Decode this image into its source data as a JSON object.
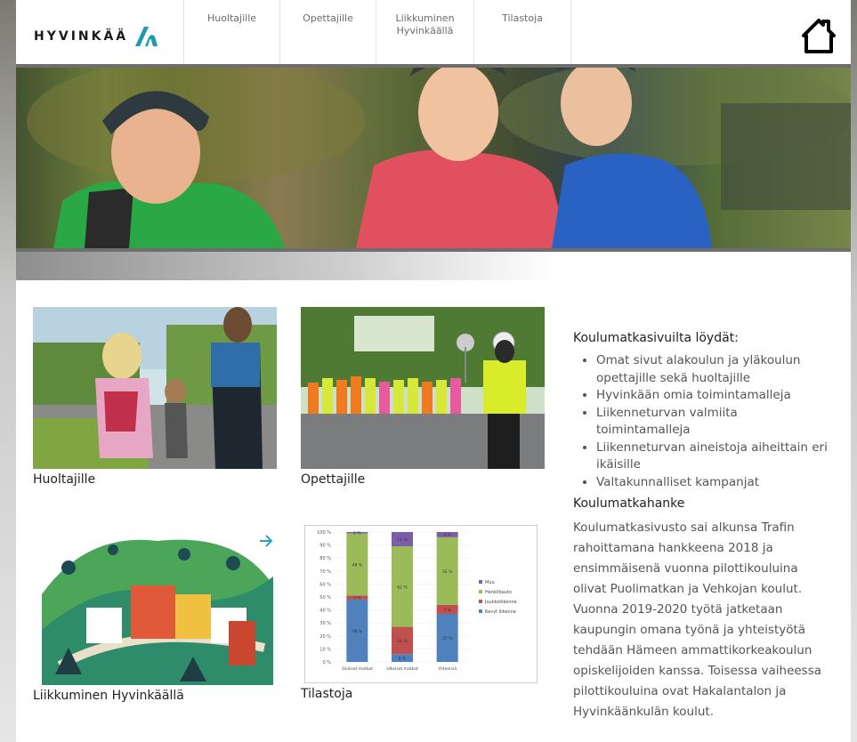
{
  "header": {
    "logo_text": "HYVINKÄÄ",
    "nav": {
      "huoltajille": "Huoltajille",
      "opettajille": "Opettajille",
      "liikkuminen_1": "Liikkuminen",
      "liikkuminen_2": "Hyvinkäällä",
      "tilastoja": "Tilastoja"
    },
    "home_icon": "home-icon"
  },
  "tiles": {
    "huoltajille": "Huoltajille",
    "opettajille": "Opettajille",
    "liikkuminen": "Liikkuminen Hyvinkäällä",
    "tilastoja": "Tilastoja"
  },
  "info": {
    "heading": "Koulumatkasivuilta löydät:",
    "items": [
      "Omat sivut alakoulun ja yläkoulun opettajille sekä huoltajille",
      "Hyvinkään omia toimintamalleja",
      "Liikenneturvan valmiita toimintamalleja",
      "Liikenneturvan aineistoja aiheittain eri ikäisille",
      "Valtakunnalliset kampanjat"
    ],
    "subheading": "Koulumatkahanke",
    "paragraph": "Koulumatkasivusto sai alkunsa Trafin rahoittamana hankkeena 2018 ja ensimmäisenä vuonna pilottikouluina olivat Puolimatkan ja Vehkojan koulut. Vuonna 2019-2020 työtä jatketaan kaupungin omana työnä ja yhteistyötä tehdään Hämeen ammattikorkeakoulun opiskelijoiden kanssa. Toisessa vaiheessa pilottikouluina ovat Hakalantalon ja Hyvinkäänkulän koulut."
  },
  "thumb_chart": {
    "y_ticks": [
      "100 %",
      "90 %",
      "80 %",
      "70 %",
      "60 %",
      "50 %",
      "40 %",
      "30 %",
      "20 %",
      "10 %",
      "0 %"
    ],
    "categories": [
      "Sisäiset matkat",
      "Ulkoiset matkat",
      "Yhteensä"
    ],
    "legend": [
      "Muu",
      "Henkilöauto",
      "Joukkoliikenne",
      "Kevyt liikenne"
    ],
    "colors": {
      "muu": "#7b5ea7",
      "henkiloauto": "#9bbb59",
      "joukkoliikenne": "#c0504d",
      "kevyt": "#4f81bd"
    },
    "stacks": [
      {
        "kevyt": 48,
        "joukko": 3,
        "auto": 48,
        "muu": 1,
        "labels": [
          "48 %",
          "3 %",
          "48 %",
          "1 %"
        ]
      },
      {
        "kevyt": 6,
        "joukko": 21,
        "auto": 62,
        "muu": 11,
        "labels": [
          "6 %",
          "21 %",
          "62 %",
          "11 %"
        ]
      },
      {
        "kevyt": 37,
        "joukko": 7,
        "auto": 52,
        "muu": 4,
        "labels": [
          "37 %",
          "7 %",
          "52 %",
          "4 %"
        ]
      }
    ]
  }
}
